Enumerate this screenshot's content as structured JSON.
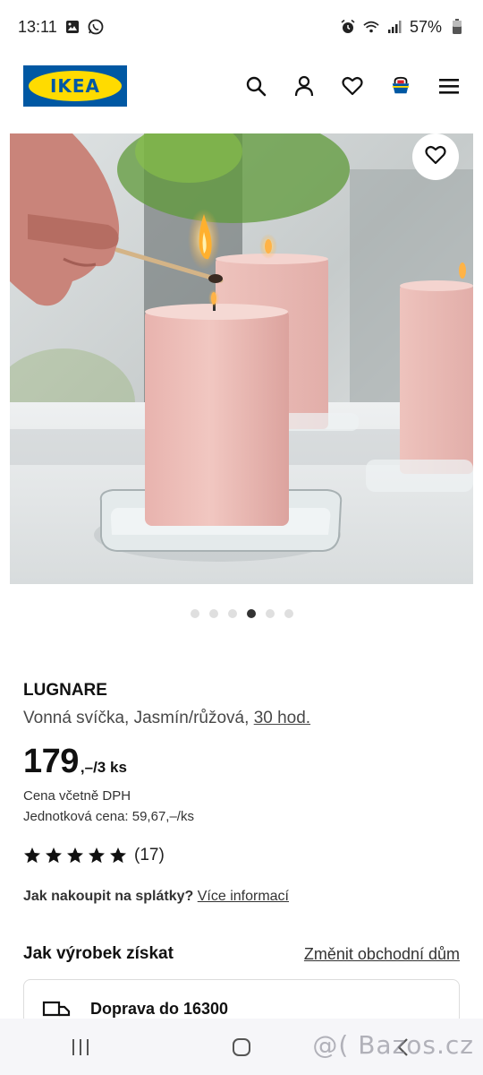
{
  "status_bar": {
    "time": "13:11",
    "battery": "57%",
    "left_icons": [
      "gallery-icon",
      "whatsapp-icon"
    ],
    "right_icons": [
      "alarm-icon",
      "wifi-icon",
      "signal-icon",
      "battery-icon"
    ]
  },
  "header": {
    "logo_text": "IKEA",
    "icons": [
      "search-icon",
      "user-icon",
      "heart-icon",
      "basket-icon",
      "menu-icon"
    ],
    "brand_colors": {
      "blue": "#0058a3",
      "yellow": "#ffdb00"
    }
  },
  "hero": {
    "favourite_icon": "heart-icon",
    "carousel": {
      "count": 6,
      "active": 4
    }
  },
  "product": {
    "name": "LUGNARE",
    "description_prefix": "Vonná svíčka, Jasmín/růžová, ",
    "description_link": "30 hod.",
    "price_main": "179",
    "price_suffix": ",–/3 ks",
    "vat_note": "Cena včetně DPH",
    "unit_price": "Jednotková cena: 59,67,–/ks",
    "rating": {
      "stars": 5,
      "count_label": "(17)"
    },
    "installment_label": "Jak nakoupit na splátky?",
    "installment_link": "Více informací"
  },
  "availability": {
    "title": "Jak výrobek získat",
    "change_store_link": "Změnit obchodní dům",
    "delivery_label": "Doprava do 16300"
  },
  "watermark": "@( Bazos.cz"
}
